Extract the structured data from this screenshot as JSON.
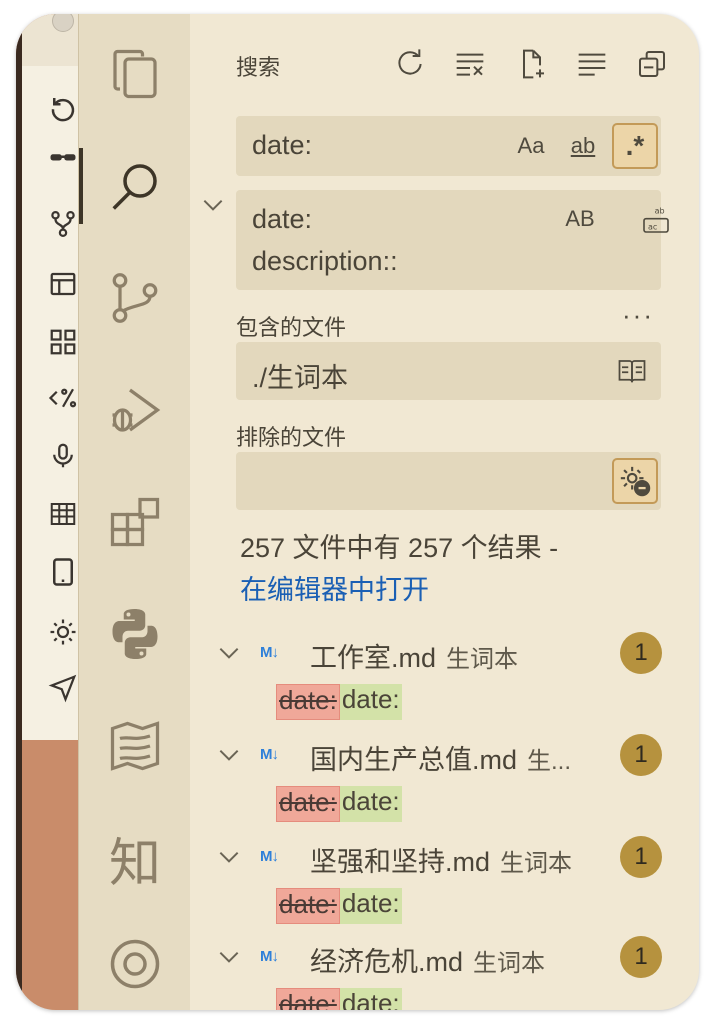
{
  "sidebar": {
    "title": "搜索",
    "search": {
      "value": "date:",
      "options": {
        "match_case": "Aa",
        "whole_word": "ab",
        "regex": ".*"
      }
    },
    "replace": {
      "line1": "date:",
      "line2": "description::",
      "preserve_case": "AB"
    },
    "include": {
      "label": "包含的文件",
      "value": "./生词本"
    },
    "exclude": {
      "label": "排除的文件",
      "value": ""
    },
    "more": "···",
    "summary": "257 文件中有 257 个结果 -",
    "open_in_editor": "在编辑器中打开",
    "results": [
      {
        "name": "工作室.md",
        "dir": "生词本",
        "count": "1",
        "match_old": "date:",
        "match_new": "date:"
      },
      {
        "name": "国内生产总值.md",
        "dir": "生...",
        "count": "1",
        "match_old": "date:",
        "match_new": "date:"
      },
      {
        "name": "坚强和坚持.md",
        "dir": "生词本",
        "count": "1",
        "match_old": "date:",
        "match_new": "date:"
      },
      {
        "name": "经济危机.md",
        "dir": "生词本",
        "count": "1",
        "match_old": "date:",
        "match_new": "date:"
      }
    ],
    "md_icon": "M↓"
  },
  "activity_bar": {
    "items": [
      "explorer-icon",
      "search-icon",
      "source-control-icon",
      "run-debug-icon",
      "extensions-icon",
      "python-icon",
      "map-icon",
      "zhihu-icon",
      "target-icon"
    ],
    "zhihu_glyph": "知"
  },
  "colors": {
    "background": "#f1e8d3",
    "accent_link": "#1a5fb4",
    "badge": "#b6923e",
    "deleted": "#f0a899",
    "inserted": "#d3e2a8"
  }
}
